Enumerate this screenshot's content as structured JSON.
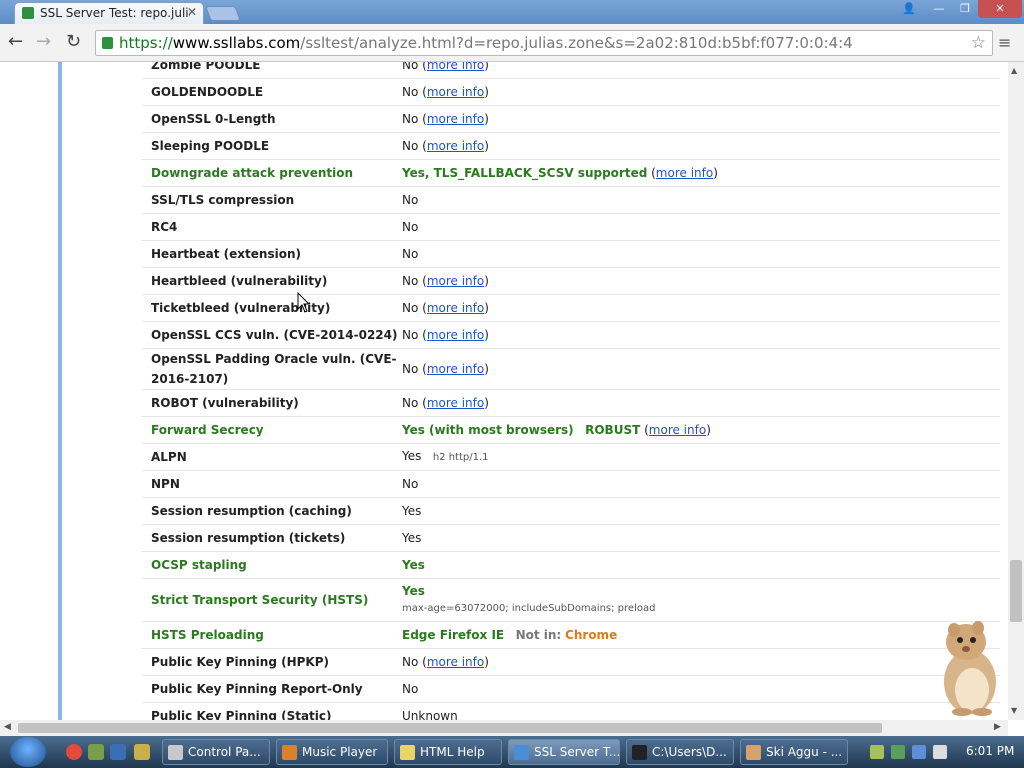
{
  "browser": {
    "tab_title": "SSL Server Test: repo.julias",
    "url_scheme": "https://",
    "url_host": "www.ssllabs.com",
    "url_path": "/ssltest/analyze.html?d=repo.julias.zone&s=2a02:810d:b5bf:f077:0:0:4:4"
  },
  "rows": [
    {
      "label": "Zombie POODLE",
      "value": "No",
      "link": "more info",
      "style": "normal"
    },
    {
      "label": "GOLDENDOODLE",
      "value": "No",
      "link": "more info",
      "style": "normal"
    },
    {
      "label": "OpenSSL 0-Length",
      "value": "No",
      "link": "more info",
      "style": "normal"
    },
    {
      "label": "Sleeping POODLE",
      "value": "No",
      "link": "more info",
      "style": "normal"
    },
    {
      "label": "Downgrade attack prevention",
      "value": "Yes, TLS_FALLBACK_SCSV supported",
      "link": "more info",
      "style": "green"
    },
    {
      "label": "SSL/TLS compression",
      "value": "No",
      "style": "normal"
    },
    {
      "label": "RC4",
      "value": "No",
      "style": "normal"
    },
    {
      "label": "Heartbeat (extension)",
      "value": "No",
      "style": "normal"
    },
    {
      "label": "Heartbleed (vulnerability)",
      "value": "No",
      "link": "more info",
      "style": "normal"
    },
    {
      "label": "Ticketbleed (vulnerability)",
      "value": "No",
      "link": "more info",
      "style": "normal"
    },
    {
      "label": "OpenSSL CCS vuln. (CVE-2014-0224)",
      "value": "No",
      "link": "more info",
      "style": "normal"
    },
    {
      "label": "OpenSSL Padding Oracle vuln. (CVE-2016-2107)",
      "value": "No",
      "link": "more info",
      "style": "normal"
    },
    {
      "label": "ROBOT (vulnerability)",
      "value": "No",
      "link": "more info",
      "style": "normal"
    },
    {
      "label": "Forward Secrecy",
      "value": "Yes (with most browsers)",
      "extra": "ROBUST",
      "link": "more info",
      "style": "green"
    },
    {
      "label": "ALPN",
      "value": "Yes",
      "note": "h2 http/1.1",
      "style": "normal"
    },
    {
      "label": "NPN",
      "value": "No",
      "style": "normal"
    },
    {
      "label": "Session resumption (caching)",
      "value": "Yes",
      "style": "normal"
    },
    {
      "label": "Session resumption (tickets)",
      "value": "Yes",
      "style": "normal"
    },
    {
      "label": "OCSP stapling",
      "value": "Yes",
      "style": "green"
    },
    {
      "label": "Strict Transport Security (HSTS)",
      "value": "Yes",
      "note": "max-age=63072000; includeSubDomains; preload",
      "style": "green"
    },
    {
      "label": "HSTS Preloading",
      "value": "Edge  Firefox  IE",
      "notin_label": "Not in:",
      "notin": "Chrome",
      "style": "green"
    },
    {
      "label": "Public Key Pinning (HPKP)",
      "value": "No",
      "link": "more info",
      "style": "normal"
    },
    {
      "label": "Public Key Pinning Report-Only",
      "value": "No",
      "style": "normal"
    },
    {
      "label": "Public Key Pinning (Static)",
      "value": "Unknown",
      "style": "normal"
    }
  ],
  "taskbar": {
    "tasks": [
      {
        "label": "Control Pa...",
        "color": "#c9c9c9"
      },
      {
        "label": "Music Player",
        "color": "#d9822b"
      },
      {
        "label": "HTML Help",
        "color": "#e8d56a"
      },
      {
        "label": "SSL Server T...",
        "color": "#4a8fd6",
        "active": true
      },
      {
        "label": "C:\\Users\\D...",
        "color": "#222222"
      },
      {
        "label": "Ski Aggu - ...",
        "color": "#d6a16a"
      }
    ],
    "clock": "6:01 PM"
  },
  "colors": {
    "green": "#2b7a1f",
    "link": "#1f55c7",
    "orange": "#e07b1a"
  }
}
